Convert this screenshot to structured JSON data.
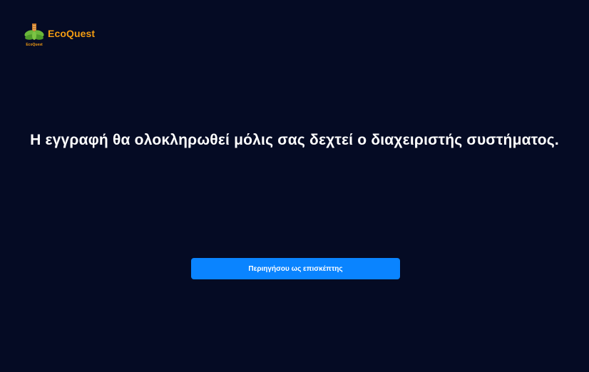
{
  "brand": {
    "name": "EcoQuest",
    "mark_caption": "EcoQuest",
    "icon": "leaf-building-logo",
    "color": "#f39c12"
  },
  "main": {
    "message": "Η εγγραφή θα ολοκληρωθεί μόλις σας δεχτεί ο διαχειριστής συστήματος."
  },
  "actions": {
    "guest_button_label": "Περιηγήσου ως επισκέπτης",
    "button_color": "#0a84ff"
  },
  "theme": {
    "background": "#050b24",
    "text": "#ffffff"
  }
}
